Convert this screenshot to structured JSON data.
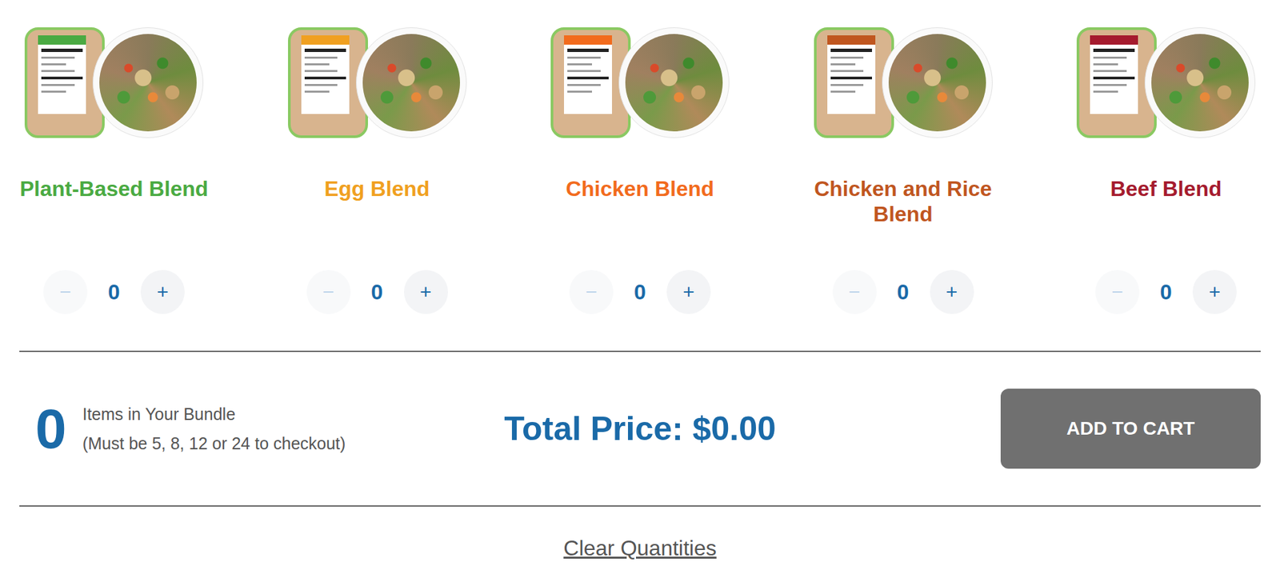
{
  "products": [
    {
      "name": "Plant-Based Blend",
      "quantity": "0",
      "color": "#4aaa42",
      "decrement_disabled": true
    },
    {
      "name": "Egg Blend",
      "quantity": "0",
      "color": "#f0a020",
      "decrement_disabled": true
    },
    {
      "name": "Chicken Blend",
      "quantity": "0",
      "color": "#f26b1d",
      "decrement_disabled": true
    },
    {
      "name": "Chicken and Rice Blend",
      "quantity": "0",
      "color": "#c0561f",
      "decrement_disabled": true
    },
    {
      "name": "Beef Blend",
      "quantity": "0",
      "color": "#a51b2e",
      "decrement_disabled": true
    }
  ],
  "controls": {
    "decrement": "−",
    "increment": "+"
  },
  "bundle": {
    "count": "0",
    "label": "Items in Your Bundle",
    "note": "(Must be 5, 8, 12 or 24 to checkout)"
  },
  "total": {
    "label": "Total Price:",
    "value": "$0.00"
  },
  "add_to_cart": {
    "label": "ADD TO CART",
    "disabled": true
  },
  "clear": "Clear Quantities"
}
